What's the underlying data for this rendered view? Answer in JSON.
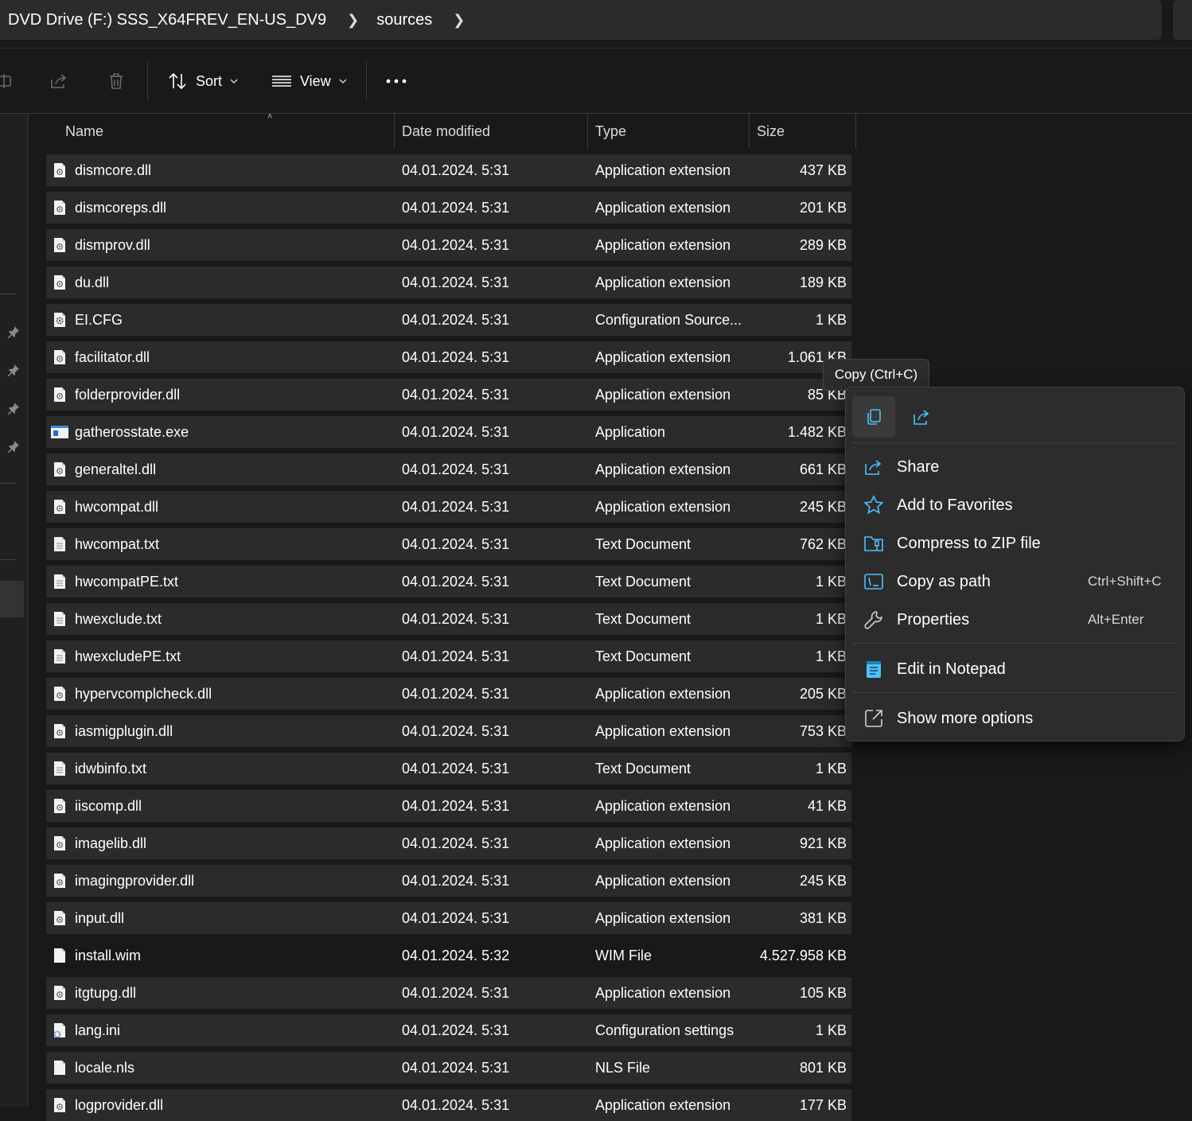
{
  "address_bar": {
    "segments": [
      "DVD Drive (F:) SSS_X64FREV_EN-US_DV9",
      "sources"
    ],
    "separator_icon": "chevron-right-icon"
  },
  "command_bar": {
    "buttons": [
      {
        "name": "rename",
        "icon": "rename-icon"
      },
      {
        "name": "share",
        "icon": "share-icon"
      },
      {
        "name": "delete",
        "icon": "trash-icon"
      }
    ],
    "sort_label": "Sort",
    "view_label": "View",
    "more_icon": "ellipsis-icon"
  },
  "columns": {
    "name": "Name",
    "date": "Date modified",
    "type": "Type",
    "size": "Size",
    "sorted_by": "Name",
    "sort_direction": "ascending"
  },
  "files": [
    {
      "name": "dismcore.dll",
      "date": "04.01.2024. 5:31",
      "type": "Application extension",
      "size": "437 KB",
      "icon": "dll-icon",
      "selected": true
    },
    {
      "name": "dismcoreps.dll",
      "date": "04.01.2024. 5:31",
      "type": "Application extension",
      "size": "201 KB",
      "icon": "dll-icon",
      "selected": true
    },
    {
      "name": "dismprov.dll",
      "date": "04.01.2024. 5:31",
      "type": "Application extension",
      "size": "289 KB",
      "icon": "dll-icon",
      "selected": true
    },
    {
      "name": "du.dll",
      "date": "04.01.2024. 5:31",
      "type": "Application extension",
      "size": "189 KB",
      "icon": "dll-icon",
      "selected": true
    },
    {
      "name": "EI.CFG",
      "date": "04.01.2024. 5:31",
      "type": "Configuration Source...",
      "size": "1 KB",
      "icon": "config-file-icon",
      "selected": true
    },
    {
      "name": "facilitator.dll",
      "date": "04.01.2024. 5:31",
      "type": "Application extension",
      "size": "1.061 KB",
      "icon": "dll-icon",
      "selected": true
    },
    {
      "name": "folderprovider.dll",
      "date": "04.01.2024. 5:31",
      "type": "Application extension",
      "size": "85 KB",
      "icon": "dll-icon",
      "selected": true
    },
    {
      "name": "gatherosstate.exe",
      "date": "04.01.2024. 5:31",
      "type": "Application",
      "size": "1.482 KB",
      "icon": "exe-icon",
      "selected": true
    },
    {
      "name": "generaltel.dll",
      "date": "04.01.2024. 5:31",
      "type": "Application extension",
      "size": "661 KB",
      "icon": "dll-icon",
      "selected": true
    },
    {
      "name": "hwcompat.dll",
      "date": "04.01.2024. 5:31",
      "type": "Application extension",
      "size": "245 KB",
      "icon": "dll-icon",
      "selected": true
    },
    {
      "name": "hwcompat.txt",
      "date": "04.01.2024. 5:31",
      "type": "Text Document",
      "size": "762 KB",
      "icon": "text-file-icon",
      "selected": true
    },
    {
      "name": "hwcompatPE.txt",
      "date": "04.01.2024. 5:31",
      "type": "Text Document",
      "size": "1 KB",
      "icon": "text-file-icon",
      "selected": true
    },
    {
      "name": "hwexclude.txt",
      "date": "04.01.2024. 5:31",
      "type": "Text Document",
      "size": "1 KB",
      "icon": "text-file-icon",
      "selected": true
    },
    {
      "name": "hwexcludePE.txt",
      "date": "04.01.2024. 5:31",
      "type": "Text Document",
      "size": "1 KB",
      "icon": "text-file-icon",
      "selected": true
    },
    {
      "name": "hypervcomplcheck.dll",
      "date": "04.01.2024. 5:31",
      "type": "Application extension",
      "size": "205 KB",
      "icon": "dll-icon",
      "selected": true
    },
    {
      "name": "iasmigplugin.dll",
      "date": "04.01.2024. 5:31",
      "type": "Application extension",
      "size": "753 KB",
      "icon": "dll-icon",
      "selected": true
    },
    {
      "name": "idwbinfo.txt",
      "date": "04.01.2024. 5:31",
      "type": "Text Document",
      "size": "1 KB",
      "icon": "text-file-icon",
      "selected": true
    },
    {
      "name": "iiscomp.dll",
      "date": "04.01.2024. 5:31",
      "type": "Application extension",
      "size": "41 KB",
      "icon": "dll-icon",
      "selected": true
    },
    {
      "name": "imagelib.dll",
      "date": "04.01.2024. 5:31",
      "type": "Application extension",
      "size": "921 KB",
      "icon": "dll-icon",
      "selected": true
    },
    {
      "name": "imagingprovider.dll",
      "date": "04.01.2024. 5:31",
      "type": "Application extension",
      "size": "245 KB",
      "icon": "dll-icon",
      "selected": true
    },
    {
      "name": "input.dll",
      "date": "04.01.2024. 5:31",
      "type": "Application extension",
      "size": "381 KB",
      "icon": "dll-icon",
      "selected": true
    },
    {
      "name": "install.wim",
      "date": "04.01.2024. 5:32",
      "type": "WIM File",
      "size": "4.527.958 KB",
      "icon": "blank-file-icon",
      "selected": false
    },
    {
      "name": "itgtupg.dll",
      "date": "04.01.2024. 5:31",
      "type": "Application extension",
      "size": "105 KB",
      "icon": "dll-icon",
      "selected": true
    },
    {
      "name": "lang.ini",
      "date": "04.01.2024. 5:31",
      "type": "Configuration settings",
      "size": "1 KB",
      "icon": "ini-file-icon",
      "selected": true
    },
    {
      "name": "locale.nls",
      "date": "04.01.2024. 5:31",
      "type": "NLS File",
      "size": "801 KB",
      "icon": "blank-file-icon",
      "selected": true
    },
    {
      "name": "logprovider.dll",
      "date": "04.01.2024. 5:31",
      "type": "Application extension",
      "size": "177 KB",
      "icon": "dll-icon",
      "selected": true
    }
  ],
  "tooltip": {
    "text": "Copy (Ctrl+C)"
  },
  "context_menu": {
    "quick_actions": [
      {
        "name": "copy",
        "icon": "copy-icon",
        "hovered": true
      },
      {
        "name": "share",
        "icon": "share-icon",
        "hovered": false
      }
    ],
    "items": [
      {
        "label": "Share",
        "shortcut": "",
        "icon": "share-icon"
      },
      {
        "label": "Add to Favorites",
        "shortcut": "",
        "icon": "star-icon"
      },
      {
        "label": "Compress to ZIP file",
        "shortcut": "",
        "icon": "zip-folder-icon"
      },
      {
        "label": "Copy as path",
        "shortcut": "Ctrl+Shift+C",
        "icon": "copy-path-icon"
      },
      {
        "label": "Properties",
        "shortcut": "Alt+Enter",
        "icon": "wrench-icon"
      },
      {
        "label": "Edit in Notepad",
        "shortcut": "",
        "icon": "notepad-icon"
      },
      {
        "label": "Show more options",
        "shortcut": "",
        "icon": "open-external-icon"
      }
    ]
  },
  "colors": {
    "background": "#191919",
    "row_selected": "#2b2b2b",
    "menu_background": "#2c2c2c",
    "accent": "#4cc2ff",
    "text": "#ffffff"
  }
}
